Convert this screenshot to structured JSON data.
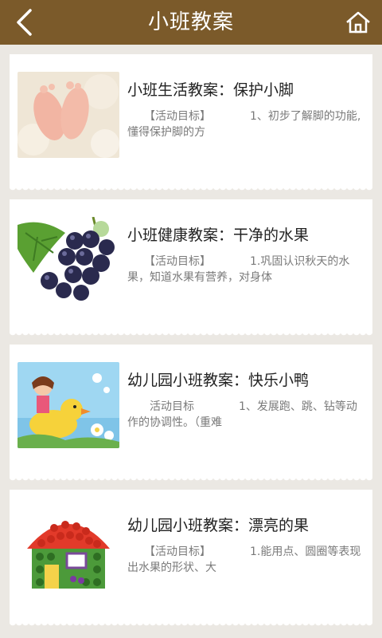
{
  "header": {
    "title": "小班教案"
  },
  "items": [
    {
      "title": "小班生活教案：保护小脚",
      "desc": "　　【活动目标】　　　　1、初步了解脚的功能,懂得保护脚的方"
    },
    {
      "title": "小班健康教案：干净的水果",
      "desc": "　　【活动目标】　　　　1.巩固认识秋天的水果，知道水果有营养，对身体"
    },
    {
      "title": "幼儿园小班教案：快乐小鸭",
      "desc": "　　活动目标　　　　1、发展跑、跳、钻等动作的协调性。（重难"
    },
    {
      "title": "幼儿园小班教案：漂亮的果",
      "desc": "　　【活动目标】　　　　1.能用点、圆圈等表现出水果的形状、大"
    }
  ],
  "colors": {
    "header": "#7b5a2a",
    "background": "#ebe8e3"
  },
  "icons": {
    "back": "chevron-left-icon",
    "home": "home-icon"
  }
}
